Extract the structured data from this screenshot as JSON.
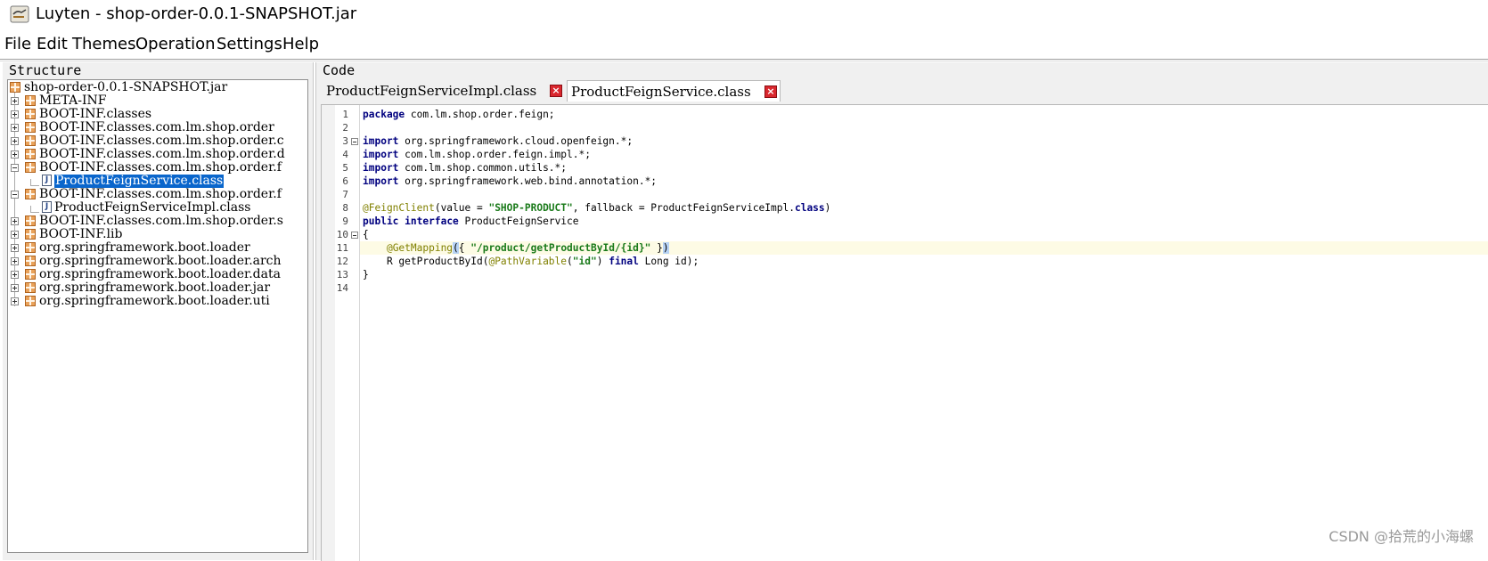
{
  "window": {
    "title": "Luyten - shop-order-0.0.1-SNAPSHOT.jar",
    "icon": "luyten-app-icon"
  },
  "menu": [
    "File",
    "Edit",
    "Themes",
    "Operation",
    "Settings",
    "Help"
  ],
  "structure": {
    "title": "Structure",
    "tree": [
      {
        "label": "shop-order-0.0.1-SNAPSHOT.jar",
        "type": "root"
      },
      {
        "label": "META-INF",
        "type": "package",
        "expanded": false
      },
      {
        "label": "BOOT-INF.classes",
        "type": "package",
        "expanded": false
      },
      {
        "label": "BOOT-INF.classes.com.lm.shop.order",
        "type": "package",
        "expanded": false
      },
      {
        "label": "BOOT-INF.classes.com.lm.shop.order.c",
        "type": "package",
        "expanded": false
      },
      {
        "label": "BOOT-INF.classes.com.lm.shop.order.d",
        "type": "package",
        "expanded": false
      },
      {
        "label": "BOOT-INF.classes.com.lm.shop.order.f",
        "type": "package",
        "expanded": true
      },
      {
        "label": "ProductFeignService.class",
        "type": "class",
        "selected": true
      },
      {
        "label": "BOOT-INF.classes.com.lm.shop.order.f",
        "type": "package",
        "expanded": true
      },
      {
        "label": "ProductFeignServiceImpl.class",
        "type": "class",
        "selected": false
      },
      {
        "label": "BOOT-INF.classes.com.lm.shop.order.s",
        "type": "package",
        "expanded": false
      },
      {
        "label": "BOOT-INF.lib",
        "type": "package",
        "expanded": false
      },
      {
        "label": "org.springframework.boot.loader",
        "type": "package",
        "expanded": false
      },
      {
        "label": "org.springframework.boot.loader.arch",
        "type": "package",
        "expanded": false
      },
      {
        "label": "org.springframework.boot.loader.data",
        "type": "package",
        "expanded": false
      },
      {
        "label": "org.springframework.boot.loader.jar",
        "type": "package",
        "expanded": false
      },
      {
        "label": "org.springframework.boot.loader.uti",
        "type": "package",
        "expanded": false
      }
    ]
  },
  "code": {
    "title": "Code",
    "tabs": [
      {
        "label": "ProductFeignServiceImpl.class",
        "active": false
      },
      {
        "label": "ProductFeignService.class",
        "active": true
      }
    ],
    "highlighted_line": 11,
    "lines": [
      "package com.lm.shop.order.feign;",
      "",
      "import org.springframework.cloud.openfeign.*;",
      "import com.lm.shop.order.feign.impl.*;",
      "import com.lm.shop.common.utils.*;",
      "import org.springframework.web.bind.annotation.*;",
      "",
      "@FeignClient(value = \"SHOP-PRODUCT\", fallback = ProductFeignServiceImpl.class)",
      "public interface ProductFeignService",
      "{",
      "    @GetMapping({ \"/product/getProductById/{id}\" })",
      "    R getProductById(@PathVariable(\"id\") final Long id);",
      "}",
      ""
    ],
    "fold_markers": [
      3,
      10
    ]
  },
  "watermark": "CSDN @拾荒的小海螺"
}
